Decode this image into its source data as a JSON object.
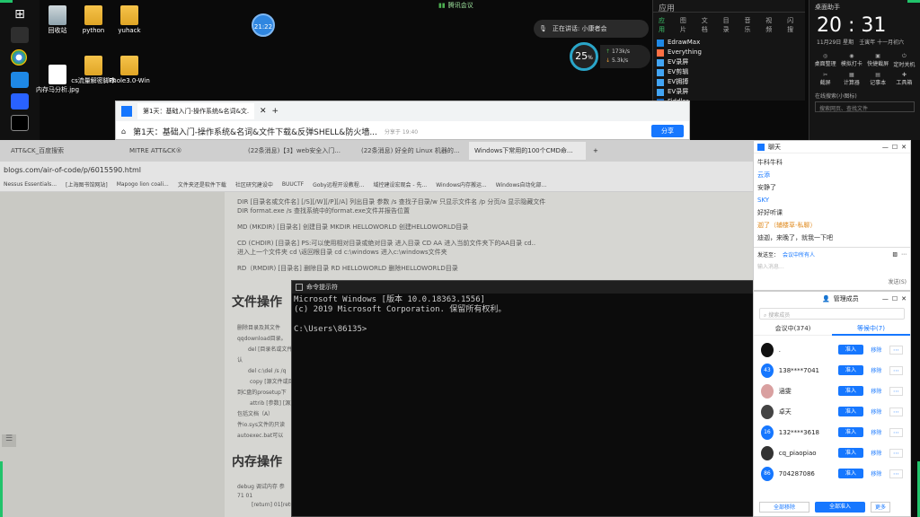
{
  "taskbar": {
    "icons": [
      "windows-icon",
      "folder-icon",
      "mail-icon",
      "chrome-icon",
      "pin-icon",
      "meeting-icon",
      "terminal-icon"
    ]
  },
  "desktop": {
    "icons": [
      {
        "label": "回收站",
        "name": "recycle-bin-icon"
      },
      {
        "label": "python",
        "name": "python-folder-icon"
      },
      {
        "label": "yuhack",
        "name": "yuhack-folder-icon"
      },
      {
        "label": "内存马分析.jpg",
        "name": "image-file-icon"
      },
      {
        "label": "cs流量解密脚本",
        "name": "cs-folder-icon"
      },
      {
        "label": "Fhole3.0-Win",
        "name": "fhole-folder-icon"
      }
    ],
    "clock_badge": "21:22",
    "speed_widget": {
      "percent": "25",
      "unit": "%",
      "up": "173k/s",
      "down": "5.3k/s"
    }
  },
  "top_notice": {
    "title": "腾讯会议",
    "speaking": "正在讲话: 小康者会"
  },
  "start_menu": {
    "tabs": [
      "应用",
      "图片",
      "文档",
      "目录",
      "音乐",
      "视频",
      "闪搜"
    ],
    "section_label": "应用",
    "apps": [
      "EdrawMax",
      "Everything",
      "EV录屏",
      "EV剪辑",
      "EV拥搏",
      "EV录屏",
      "Fiddler"
    ]
  },
  "clock_widget": {
    "title": "桌面助手",
    "time": "20 : 31",
    "date": "11月29日  星期",
    "lunar": "壬寅年 十一月初六",
    "actions": [
      "桌面整理",
      "模拟打卡",
      "快捷截屏",
      "定时关机",
      "截屏",
      "计算器",
      "记事本",
      "工具箱"
    ],
    "search_label": "在线搜索(小图标)",
    "search_placeholder": "搜索网页、查找文件"
  },
  "browser_small": {
    "tab": "第1天：基础入门-操作系统&名词&文...",
    "title": "第1天：基础入门-操作系统&名词&文件下载&反弹SHELL&防火墙...",
    "time": "分享于 19:40",
    "share_label": "分享"
  },
  "browser_main": {
    "tabs": [
      {
        "label": "ATT&CK_百度搜索",
        "active": false
      },
      {
        "label": "MITRE ATT&CK®",
        "active": false
      },
      {
        "label": "(22条消息)【3】web安全入门...",
        "active": false
      },
      {
        "label": "(22条消息) 好全的 Linux 机器的...",
        "active": false
      },
      {
        "label": "Windows下常用的100个CMD命...",
        "active": true
      }
    ],
    "url": "blogs.com/air-of-code/p/6015590.html",
    "bookmarks": [
      "Nessus Essentials...",
      "[上海图书馆网站]",
      "Mapogo lion coali...",
      "文件夹还是软件下载",
      "社区研究建设中",
      "BUUCTF",
      "Goby远程开设教程...",
      "域控建设宏观会 - 先...",
      "Windows内存搬运...",
      "Windows自动化部..."
    ],
    "lines": [
      "DIR [目录名或文件名] [/S][/W][/P][/A] 列出目录 参数 /s 查找子目录/w 只显示文件名 /p 分页/a 显示隐藏文件",
      "DIR format.exe /s 查找系统中的format.exe文件并报告位置",
      "MD (MKDIR) [目录名] 创建目录 MKDIR HELLOWORLD 创建HELLOWORLD目录",
      "CD (CHDIR) [目录名] PS:可以使用相对目录或绝对目录 进入目录 CD AA 进入当前文件夹下的AA目录 cd..",
      "进入上一个文件夹 cd \\返回根目录 cd c:\\windows 进入c:\\windows文件夹",
      "RD（RMDIR) [目录名] 删除目录 RD HELLOWORLD 删除HELLOWORLD目录"
    ],
    "heading1": "文件操作",
    "left_lines": [
      "删除目录及其文件",
      "qqdownload目录。",
      "del [目录名或文件名]",
      "认",
      "del c:\\del /s /q",
      "copy [源文件或目录]",
      "到C盘的prosetup下",
      "attrib [参数] [源文件]",
      "包括文档（A）",
      "件io.sys文件的只读",
      "autoexec.bat可以"
    ],
    "heading2": "内存操作",
    "bottom_lines": [
      "debug 调试内存 参",
      "71 01",
      "[return] 01[return]"
    ]
  },
  "cmd": {
    "title": "命令提示符",
    "line1": "Microsoft Windows [版本 10.0.18363.1556]",
    "line2": "(c) 2019 Microsoft Corporation. 保留所有权利。",
    "prompt": "C:\\Users\\86135>"
  },
  "chat": {
    "title": "聊天",
    "messages": [
      {
        "text": "牛科牛科",
        "color": "#333"
      },
      {
        "text": "云添",
        "color": "#1677ff"
      },
      {
        "text": "安静了",
        "color": "#333"
      },
      {
        "text": "SKY",
        "color": "#1677ff"
      },
      {
        "text": "好好听课",
        "color": "#333"
      },
      {
        "text": "迦了（辅楼草-私聊）",
        "color": "#e08a1e"
      },
      {
        "text": "迪迦，来晚了，就我一下吧",
        "color": "#333"
      }
    ],
    "send_to_label": "发送至：",
    "send_to_value": "会议中所有人",
    "input_placeholder": "输入消息...",
    "send_label": "发送(S)"
  },
  "members": {
    "title": "管理成员",
    "search_placeholder": "搜索成员",
    "tab_in": "会议中(374)",
    "tab_wait": "等候中(7)",
    "admit_label": "准入",
    "remove_label": "移除",
    "list": [
      {
        "badge": "",
        "name": ".",
        "color": "#111"
      },
      {
        "badge": "43",
        "name": "138****7041",
        "color": "#1677ff"
      },
      {
        "badge": "",
        "name": "涵雯",
        "color": "#d9a0a0"
      },
      {
        "badge": "",
        "name": "卓天",
        "color": "#444"
      },
      {
        "badge": "16",
        "name": "132****3618",
        "color": "#1677ff"
      },
      {
        "badge": "",
        "name": "cq_piaopiao",
        "color": "#333"
      },
      {
        "badge": "86",
        "name": "704287086",
        "color": "#1677ff"
      }
    ],
    "footer": [
      "全部移除",
      "全部准入",
      "更多"
    ]
  }
}
